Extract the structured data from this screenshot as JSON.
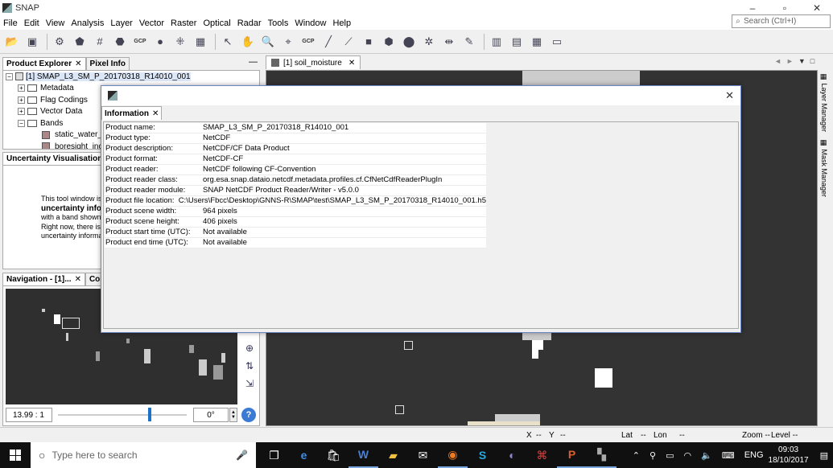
{
  "window": {
    "title": "SNAP",
    "controls": [
      "–",
      "▫",
      "✕"
    ]
  },
  "menu": [
    "File",
    "Edit",
    "View",
    "Analysis",
    "Layer",
    "Vector",
    "Raster",
    "Optical",
    "Radar",
    "Tools",
    "Window",
    "Help"
  ],
  "search": {
    "placeholder": "Search (Ctrl+I)"
  },
  "toolbar": {
    "gcp_label": "GCP"
  },
  "product_explorer": {
    "tabs": [
      {
        "label": "Product Explorer",
        "active": true
      },
      {
        "label": "Pixel Info",
        "active": false
      }
    ],
    "tree": {
      "product": "[1] SMAP_L3_SM_P_20170318_R14010_001",
      "nodes": [
        "Metadata",
        "Flag Codings",
        "Vector Data",
        "Bands"
      ],
      "bands": [
        "static_water_b",
        "boresight_incid"
      ]
    }
  },
  "uncertainty": {
    "tab": "Uncertainty Visualisation",
    "lines": [
      "This tool window is",
      "uncertainty info",
      "with a band shown",
      "Right now, there is",
      "uncertainty informa"
    ]
  },
  "navigation": {
    "tabs": [
      "Navigation - [1]...",
      "Colo"
    ],
    "scale": "13.99 : 1",
    "rotation": "0°",
    "slider_position": 0.7
  },
  "image_view": {
    "tab": "[1] soil_moisture",
    "controls": [
      "◄",
      "►",
      "▼",
      "□"
    ]
  },
  "right_strip": {
    "tabs": [
      "Layer Manager",
      "Mask Manager"
    ]
  },
  "statusbar": {
    "x": "X",
    "y": "Y",
    "sep1": "--",
    "sep2": "--",
    "lat": "Lat",
    "lon": "Lon",
    "sep3": "--",
    "sep4": "--",
    "zoom": "Zoom --",
    "level": "Level --"
  },
  "dialog": {
    "tab": "Information",
    "rows": [
      {
        "label": "Product name:",
        "value": "SMAP_L3_SM_P_20170318_R14010_001"
      },
      {
        "label": "Product type:",
        "value": "NetCDF"
      },
      {
        "label": "Product description:",
        "value": "NetCDF/CF Data Product"
      },
      {
        "label": "Product format:",
        "value": "NetCDF-CF"
      },
      {
        "label": "Product reader:",
        "value": "NetCDF following CF-Convention"
      },
      {
        "label": "Product reader class:",
        "value": "org.esa.snap.dataio.netcdf.metadata.profiles.cf.CfNetCdfReaderPlugIn"
      },
      {
        "label": "Product reader module:",
        "value": "SNAP NetCDF Product Reader/Writer - v5.0.0"
      },
      {
        "label": "Product file location:",
        "value": "C:\\Users\\Fbcc\\Desktop\\GNNS-R\\SMAP\\test\\SMAP_L3_SM_P_20170318_R14010_001.h5"
      },
      {
        "label": "Product scene width:",
        "value": "964 pixels"
      },
      {
        "label": "Product scene height:",
        "value": "406 pixels"
      },
      {
        "label": "Product start time (UTC):",
        "value": "Not available"
      },
      {
        "label": "Product end time (UTC):",
        "value": "Not available"
      }
    ]
  },
  "taskbar": {
    "search_placeholder": "Type here to search",
    "tray_lang": "ENG",
    "time": "09:03",
    "date": "18/10/2017"
  }
}
